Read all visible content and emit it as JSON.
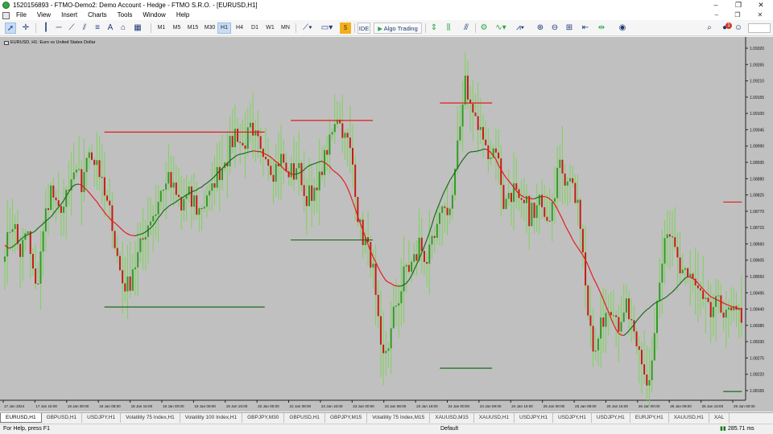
{
  "window": {
    "title": "1520156893 - FTMO-Demo2: Demo Account - Hedge - FTMO S.R.O. - [EURUSD,H1]",
    "controls": [
      "–",
      "❐",
      "✕"
    ]
  },
  "menu": {
    "items": [
      "File",
      "View",
      "Insert",
      "Charts",
      "Tools",
      "Window",
      "Help"
    ],
    "mdi_controls": [
      "–",
      "❐",
      "✕"
    ]
  },
  "toolbar": {
    "timeframes": [
      "M1",
      "M5",
      "M15",
      "M30",
      "H1",
      "H4",
      "D1",
      "W1",
      "MN"
    ],
    "active_timeframe": "H1",
    "ide_label": "IDE",
    "algo_label": "Algo Trading",
    "notification_count": "1"
  },
  "chart": {
    "title": "EURUSD, H1:  Euro vs United States Dollar",
    "symbol": "EURUSD",
    "timeframe": "H1",
    "background": "#c0c0c0",
    "bull_color": "#2e9e1e",
    "bear_color": "#c21e0e",
    "wick_color": "#7dd35a",
    "ma_up_color": "#1a6b1a",
    "ma_down_color": "#e51b1b"
  },
  "chart_data": {
    "type": "candlestick",
    "ylim": [
      1.0812,
      1.0935
    ],
    "y_ticks": [
      "1.09320",
      "1.09265",
      "1.09210",
      "1.09155",
      "1.09100",
      "1.09045",
      "1.08990",
      "1.08935",
      "1.08880",
      "1.08825",
      "1.08770",
      "1.08715",
      "1.08660",
      "1.08605",
      "1.08550",
      "1.08495",
      "1.08440",
      "1.08385",
      "1.08330",
      "1.08275",
      "1.08220",
      "1.08165"
    ],
    "x_ticks": [
      "17 Jan 2024",
      "17 Jan 16:00",
      "18 Jan 00:00",
      "18 Jan 08:00",
      "18 Jan 16:00",
      "19 Jan 00:00",
      "19 Jan 08:00",
      "19 Jan 16:00",
      "22 Jan 00:00",
      "22 Jan 08:00",
      "22 Jan 16:00",
      "23 Jan 00:00",
      "23 Jan 08:00",
      "23 Jan 16:00",
      "24 Jan 00:00",
      "24 Jan 08:00",
      "24 Jan 16:00",
      "25 Jan 00:00",
      "25 Jan 08:00",
      "25 Jan 16:00",
      "26 Jan 00:00",
      "26 Jan 08:00",
      "26 Jan 16:00",
      "29 Jan 00:00"
    ],
    "close_path": [
      1.0866,
      1.0873,
      1.0862,
      1.0868,
      1.0848,
      1.087,
      1.0884,
      1.0876,
      1.088,
      1.0888,
      1.0886,
      1.0898,
      1.0895,
      1.088,
      1.0873,
      1.0856,
      1.0852,
      1.086,
      1.0868,
      1.0873,
      1.088,
      1.0887,
      1.0884,
      1.0878,
      1.0882,
      1.0878,
      1.088,
      1.0885,
      1.089,
      1.0896,
      1.0903,
      1.0898,
      1.0904,
      1.0898,
      1.0897,
      1.0891,
      1.0895,
      1.0889,
      1.0892,
      1.0884,
      1.0881,
      1.0889,
      1.0895,
      1.091,
      1.0905,
      1.0899,
      1.0876,
      1.0866,
      1.0856,
      1.0826,
      1.083,
      1.0846,
      1.0855,
      1.0859,
      1.0865,
      1.0862,
      1.0866,
      1.088,
      1.0876,
      1.0898,
      1.0922,
      1.091,
      1.0903,
      1.0898,
      1.0898,
      1.088,
      1.0885,
      1.0878,
      1.0878,
      1.0875,
      1.088,
      1.0876,
      1.0892,
      1.089,
      1.0887,
      1.087,
      1.084,
      1.083,
      1.0838,
      1.0843,
      1.0839,
      1.0845,
      1.0834,
      1.0827,
      1.082,
      1.0843,
      1.0867,
      1.0865,
      1.0858,
      1.0856,
      1.0852,
      1.0844,
      1.0842,
      1.0844,
      1.0843,
      1.0842,
      1.084
    ],
    "moving_average": {
      "color_up": "#1a6b1a",
      "color_down": "#e51b1b"
    },
    "levels": [
      {
        "kind": "resistance",
        "value": 1.0904,
        "color": "#e51b1b"
      },
      {
        "kind": "support",
        "value": 1.0844,
        "color": "#1a6b1a"
      },
      {
        "kind": "resistance",
        "value": 1.0908,
        "color": "#e51b1b"
      },
      {
        "kind": "support",
        "value": 1.0867,
        "color": "#1a6b1a"
      },
      {
        "kind": "resistance",
        "value": 1.0914,
        "color": "#e51b1b"
      },
      {
        "kind": "support",
        "value": 1.0823,
        "color": "#1a6b1a"
      },
      {
        "kind": "resistance",
        "value": 1.088,
        "color": "#e51b1b"
      },
      {
        "kind": "support",
        "value": 1.0815,
        "color": "#1a6b1a"
      }
    ]
  },
  "tabs": [
    "EURUSD,H1",
    "GBPUSD,H1",
    "USDJPY,H1",
    "Volatility 75 Index,H1",
    "Volatility 100 Index,H1",
    "GBPJPY,M30",
    "GBPUSD,H1",
    "GBPJPY,M15",
    "Volatility 75 Index,M15",
    "XAUUSD,M15",
    "XAUUSD,H1",
    "USDJPY,H1",
    "USDJPY,H1",
    "USDJPY,H1",
    "EURJPY,H1",
    "XAUUSD,H1",
    "XAL"
  ],
  "active_tab": "EURUSD,H1",
  "status": {
    "help": "For Help, press F1",
    "profile": "Default",
    "traffic": "285.71 ms"
  }
}
